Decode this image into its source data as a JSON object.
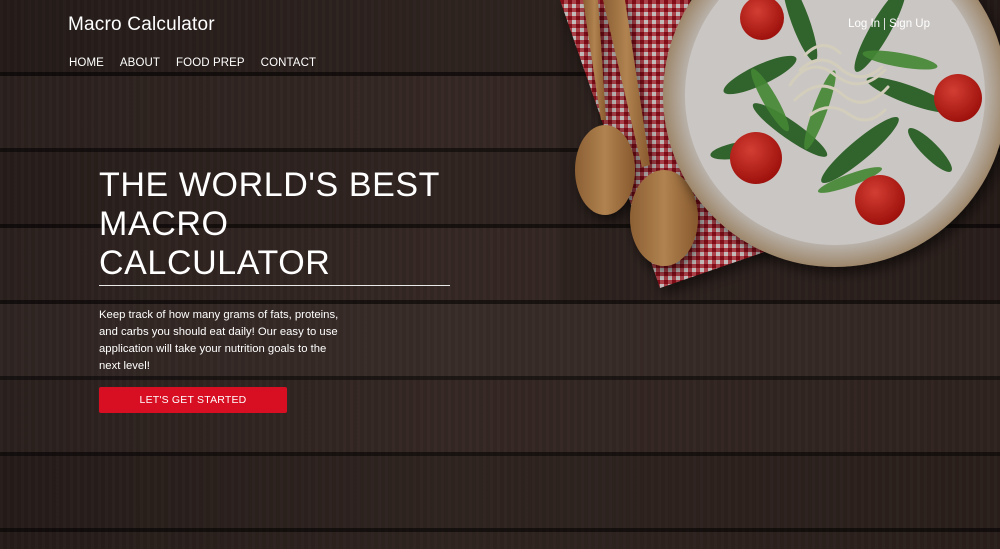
{
  "header": {
    "brand": "Macro Calculator",
    "nav": [
      "HOME",
      "ABOUT",
      "FOOD PREP",
      "CONTACT"
    ],
    "auth": {
      "login": "Log In",
      "signup": "Sign Up"
    }
  },
  "hero": {
    "title_lines": [
      "THE WORLD'S BEST",
      "MACRO",
      "CALCULATOR"
    ],
    "description": "Keep track of how many grams of fats, proteins, and carbs you should eat daily! Our easy to use application will take your nutrition goals to the next level!",
    "cta_label": "LET'S GET STARTED"
  },
  "colors": {
    "accent": "#d80f22",
    "text": "#ffffff",
    "background": "#2f231f"
  },
  "icons": [
    "salad-plate-image",
    "wooden-spoons-image",
    "checkered-napkin-image"
  ]
}
